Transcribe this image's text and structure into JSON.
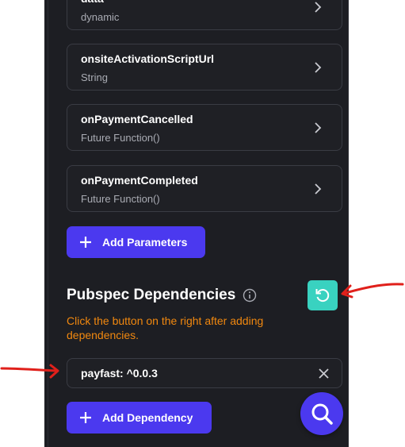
{
  "parameters": [
    {
      "name": "data",
      "type": "dynamic"
    },
    {
      "name": "onsiteActivationScriptUrl",
      "type": "String"
    },
    {
      "name": "onPaymentCancelled",
      "type": "Future Function()"
    },
    {
      "name": "onPaymentCompleted",
      "type": "Future Function()"
    }
  ],
  "add_parameters_label": "Add Parameters",
  "dependencies_section": {
    "title": "Pubspec Dependencies",
    "hint": "Click the button on the right after adding dependencies.",
    "dependency_value": "payfast: ^0.0.3",
    "add_dependency_label": "Add Dependency"
  },
  "icons": {
    "chevron": "chevron-right-icon",
    "plus": "plus-icon",
    "info": "info-icon",
    "refresh": "refresh-icon",
    "clear": "close-icon",
    "search": "search-icon"
  },
  "colors": {
    "panel_bg": "#1d1e23",
    "primary": "#4b39ef",
    "refresh_button": "#39d2c0",
    "hint_text": "#f1880f",
    "annotation_arrow": "#e0201b"
  }
}
